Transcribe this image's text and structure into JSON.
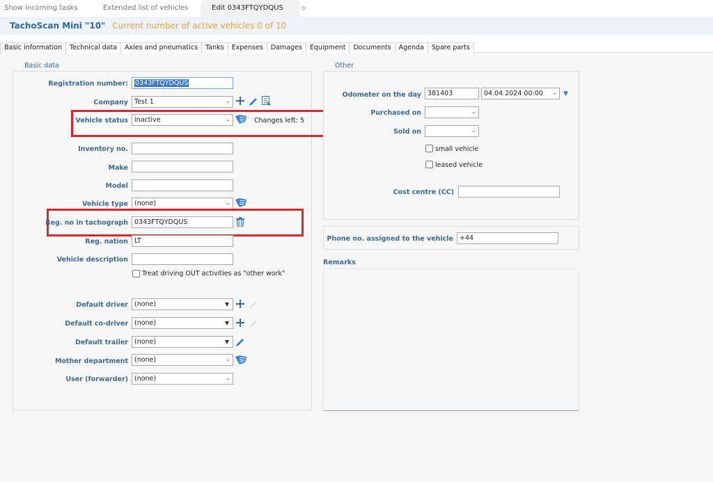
{
  "doc_tabs": [
    {
      "label": "Show incoming tasks",
      "active": false
    },
    {
      "label": "Extended list of vehicles",
      "active": false
    },
    {
      "label": "Edit 0343FTQYDQUS",
      "active": true
    }
  ],
  "add_tab_icon": "add-tab-icon",
  "license": {
    "product": "TachoScan Mini \"10\"",
    "active_vehicles_text": "Current number of active vehicles 0 of 10"
  },
  "section_tabs": [
    {
      "label": "Basic information",
      "active": true
    },
    {
      "label": "Technical data"
    },
    {
      "label": "Axles and pneumatics"
    },
    {
      "label": "Tanks"
    },
    {
      "label": "Expenses"
    },
    {
      "label": "Damages"
    },
    {
      "label": "Equipment"
    },
    {
      "label": "Documents"
    },
    {
      "label": "Agenda"
    },
    {
      "label": "Spare parts"
    }
  ],
  "basic_data": {
    "title": "Basic data",
    "registration_number": {
      "label": "Registration number:",
      "value": "0343FTQYDQUS"
    },
    "company": {
      "label": "Company",
      "value": "Test 1"
    },
    "vehicle_status": {
      "label": "Vehicle status",
      "value": "inactive",
      "changes_left": "Changes left: 5"
    },
    "inventory_no": {
      "label": "Inventory no.",
      "value": ""
    },
    "make": {
      "label": "Make",
      "value": ""
    },
    "model": {
      "label": "Model",
      "value": ""
    },
    "vehicle_type": {
      "label": "Vehicle type",
      "value": "(none)"
    },
    "reg_no_tachograph": {
      "label": "Reg. no in tachograph",
      "value": "0343FTQYDQUS"
    },
    "reg_nation": {
      "label": "Reg. nation",
      "value": "LT"
    },
    "vehicle_description": {
      "label": "Vehicle description",
      "value": ""
    },
    "treat_driving_out": {
      "label": "Treat driving OUT activities as \"other work\"",
      "checked": false
    },
    "default_driver": {
      "label": "Default driver",
      "value": "(none)"
    },
    "default_codriver": {
      "label": "Default co-driver",
      "value": "(none)"
    },
    "default_trailer": {
      "label": "Default trailer",
      "value": "(none)"
    },
    "mother_department": {
      "label": "Mother department",
      "value": "(none)"
    },
    "user_forwarder": {
      "label": "User (forwarder)",
      "value": "(none)"
    }
  },
  "other": {
    "title": "Other",
    "odometer": {
      "label": "Odometer on the day",
      "value": "381403",
      "date": "04.04.2024 00:00"
    },
    "purchased_on": {
      "label": "Purchased on",
      "value": ""
    },
    "sold_on": {
      "label": "Sold on",
      "value": ""
    },
    "small_vehicle": {
      "label": "small vehicle",
      "checked": false
    },
    "leased_vehicle": {
      "label": "leased vehicle",
      "checked": false
    },
    "cost_centre": {
      "label": "Cost centre (CC)",
      "value": ""
    }
  },
  "phone": {
    "label": "Phone no. assigned to the vehicle",
    "value": "+44"
  },
  "remarks": {
    "title": "Remarks",
    "value": ""
  },
  "colors": {
    "accent": "#2b6aa3",
    "license_highlight": "#e8a33c",
    "annotation_red": "#d7262e"
  }
}
